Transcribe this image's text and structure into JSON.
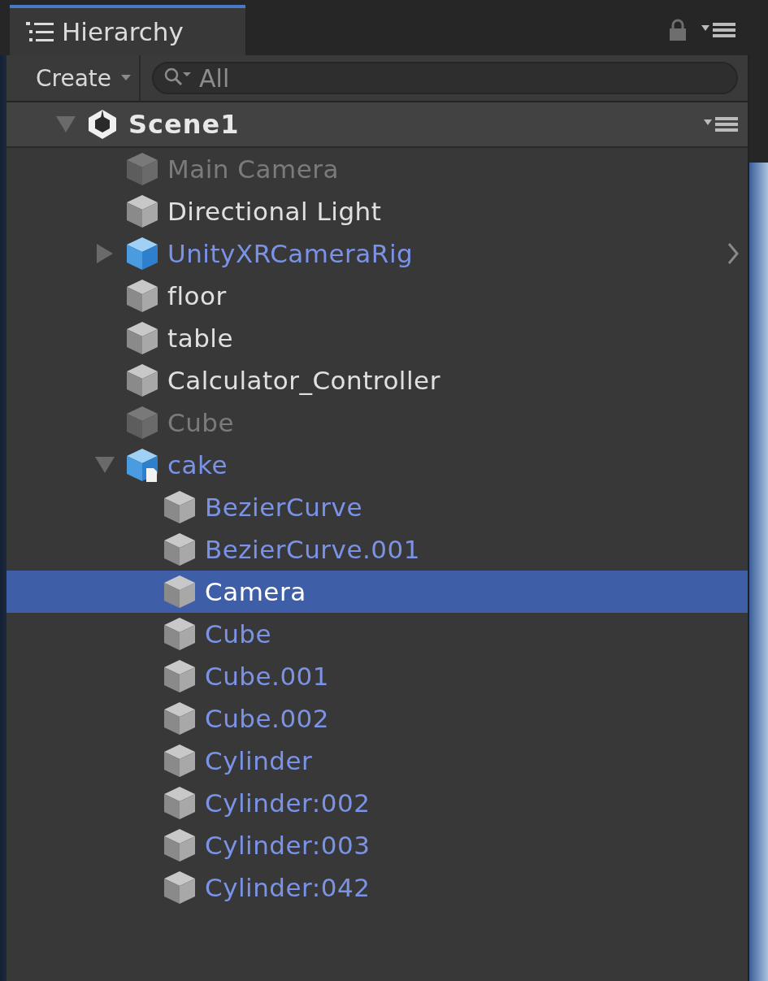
{
  "tab": {
    "label": "Hierarchy",
    "selected": true
  },
  "toolbar": {
    "create_label": "Create",
    "search": {
      "placeholder": "All"
    }
  },
  "scene": {
    "name": "Scene1",
    "expanded": true,
    "items": [
      {
        "name": "Main Camera",
        "kind": "cube",
        "active": false,
        "prefab": false,
        "selected": false
      },
      {
        "name": "Directional Light",
        "kind": "cube",
        "active": true,
        "prefab": false,
        "selected": false
      },
      {
        "name": "UnityXRCameraRig",
        "kind": "prefab",
        "active": true,
        "prefab": true,
        "selected": false,
        "expanded": false
      },
      {
        "name": "floor",
        "kind": "cube",
        "active": true,
        "prefab": false,
        "selected": false
      },
      {
        "name": "table",
        "kind": "cube",
        "active": true,
        "prefab": false,
        "selected": false
      },
      {
        "name": "Calculator_Controller",
        "kind": "cube",
        "active": true,
        "prefab": false,
        "selected": false
      },
      {
        "name": "Cube",
        "kind": "cube",
        "active": false,
        "prefab": false,
        "selected": false
      },
      {
        "name": "cake",
        "kind": "model-prefab",
        "active": true,
        "prefab": true,
        "selected": false,
        "expanded": true,
        "children": [
          {
            "name": "BezierCurve",
            "kind": "cube",
            "active": true,
            "prefab": true,
            "selected": false
          },
          {
            "name": "BezierCurve.001",
            "kind": "cube",
            "active": true,
            "prefab": true,
            "selected": false
          },
          {
            "name": "Camera",
            "kind": "cube",
            "active": true,
            "prefab": true,
            "selected": true
          },
          {
            "name": "Cube",
            "kind": "cube",
            "active": true,
            "prefab": true,
            "selected": false
          },
          {
            "name": "Cube.001",
            "kind": "cube",
            "active": true,
            "prefab": true,
            "selected": false
          },
          {
            "name": "Cube.002",
            "kind": "cube",
            "active": true,
            "prefab": true,
            "selected": false
          },
          {
            "name": "Cylinder",
            "kind": "cube",
            "active": true,
            "prefab": true,
            "selected": false
          },
          {
            "name": "Cylinder:002",
            "kind": "cube",
            "active": true,
            "prefab": true,
            "selected": false
          },
          {
            "name": "Cylinder:003",
            "kind": "cube",
            "active": true,
            "prefab": true,
            "selected": false
          },
          {
            "name": "Cylinder:042",
            "kind": "cube",
            "active": true,
            "prefab": true,
            "selected": false
          }
        ]
      }
    ]
  }
}
